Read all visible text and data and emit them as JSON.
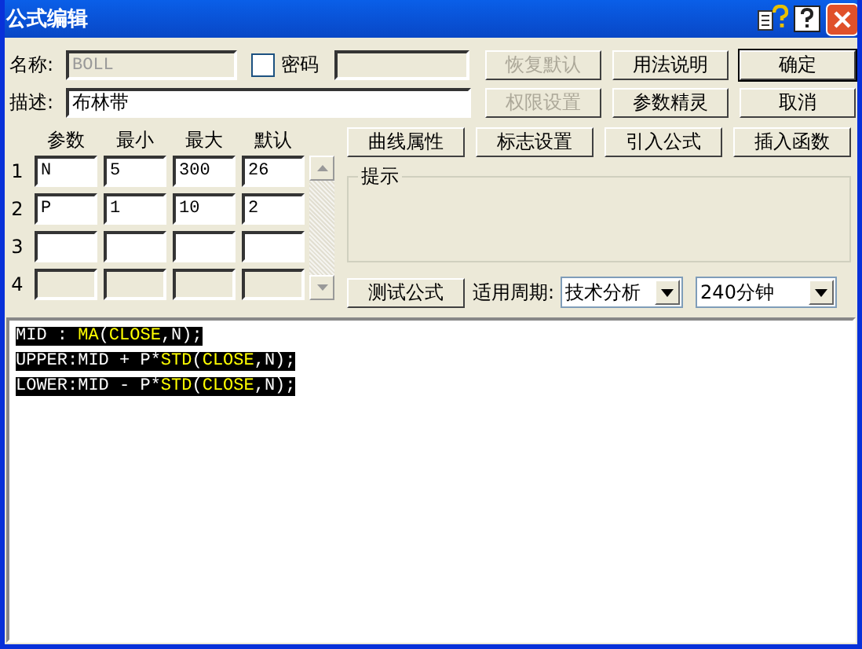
{
  "window": {
    "title": "公式编辑"
  },
  "name_field": {
    "label": "名称:",
    "value": "BOLL",
    "disabled": true
  },
  "password": {
    "label": "密码",
    "checked": false
  },
  "description": {
    "label": "描述:",
    "value": "布林带"
  },
  "buttons": [
    {
      "label": "恢复默认",
      "disabled": true,
      "default": false
    },
    {
      "label": "用法说明",
      "disabled": false,
      "default": false
    },
    {
      "label": "确定",
      "disabled": false,
      "default": true
    },
    {
      "label": "权限设置",
      "disabled": true,
      "default": false
    },
    {
      "label": "参数精灵",
      "disabled": false,
      "default": false
    },
    {
      "label": "取消",
      "disabled": false,
      "default": false
    }
  ],
  "tool_buttons": [
    "曲线属性",
    "标志设置",
    "引入公式",
    "插入函数"
  ],
  "params": {
    "columns": [
      "参数",
      "最小",
      "最大",
      "默认"
    ],
    "rows": [
      {
        "index": "1",
        "values": [
          "N",
          "5",
          "300",
          "26"
        ],
        "disabled": false
      },
      {
        "index": "2",
        "values": [
          "P",
          "1",
          "10",
          "2"
        ],
        "disabled": false
      },
      {
        "index": "3",
        "values": [],
        "disabled": false
      },
      {
        "index": "4",
        "values": [],
        "disabled": true
      }
    ]
  },
  "hint": {
    "label": "提示"
  },
  "test_button": "测试公式",
  "period": {
    "label": "适用周期:",
    "type_value": "技术分析",
    "period_value": "240分钟"
  },
  "code": [
    [
      {
        "text": "MID : ",
        "kind": "plain"
      },
      {
        "text": "MA",
        "kind": "func"
      },
      {
        "text": "(",
        "kind": "plain"
      },
      {
        "text": "CLOSE",
        "kind": "func"
      },
      {
        "text": ",N);",
        "kind": "plain"
      }
    ],
    [
      {
        "text": "UPPER:MID + P*",
        "kind": "plain"
      },
      {
        "text": "STD",
        "kind": "func"
      },
      {
        "text": "(",
        "kind": "plain"
      },
      {
        "text": "CLOSE",
        "kind": "func"
      },
      {
        "text": ",N);",
        "kind": "plain"
      }
    ],
    [
      {
        "text": "LOWER:MID - P*",
        "kind": "plain"
      },
      {
        "text": "STD",
        "kind": "func"
      },
      {
        "text": "(",
        "kind": "plain"
      },
      {
        "text": "CLOSE",
        "kind": "func"
      },
      {
        "text": ",N);",
        "kind": "plain"
      }
    ]
  ]
}
